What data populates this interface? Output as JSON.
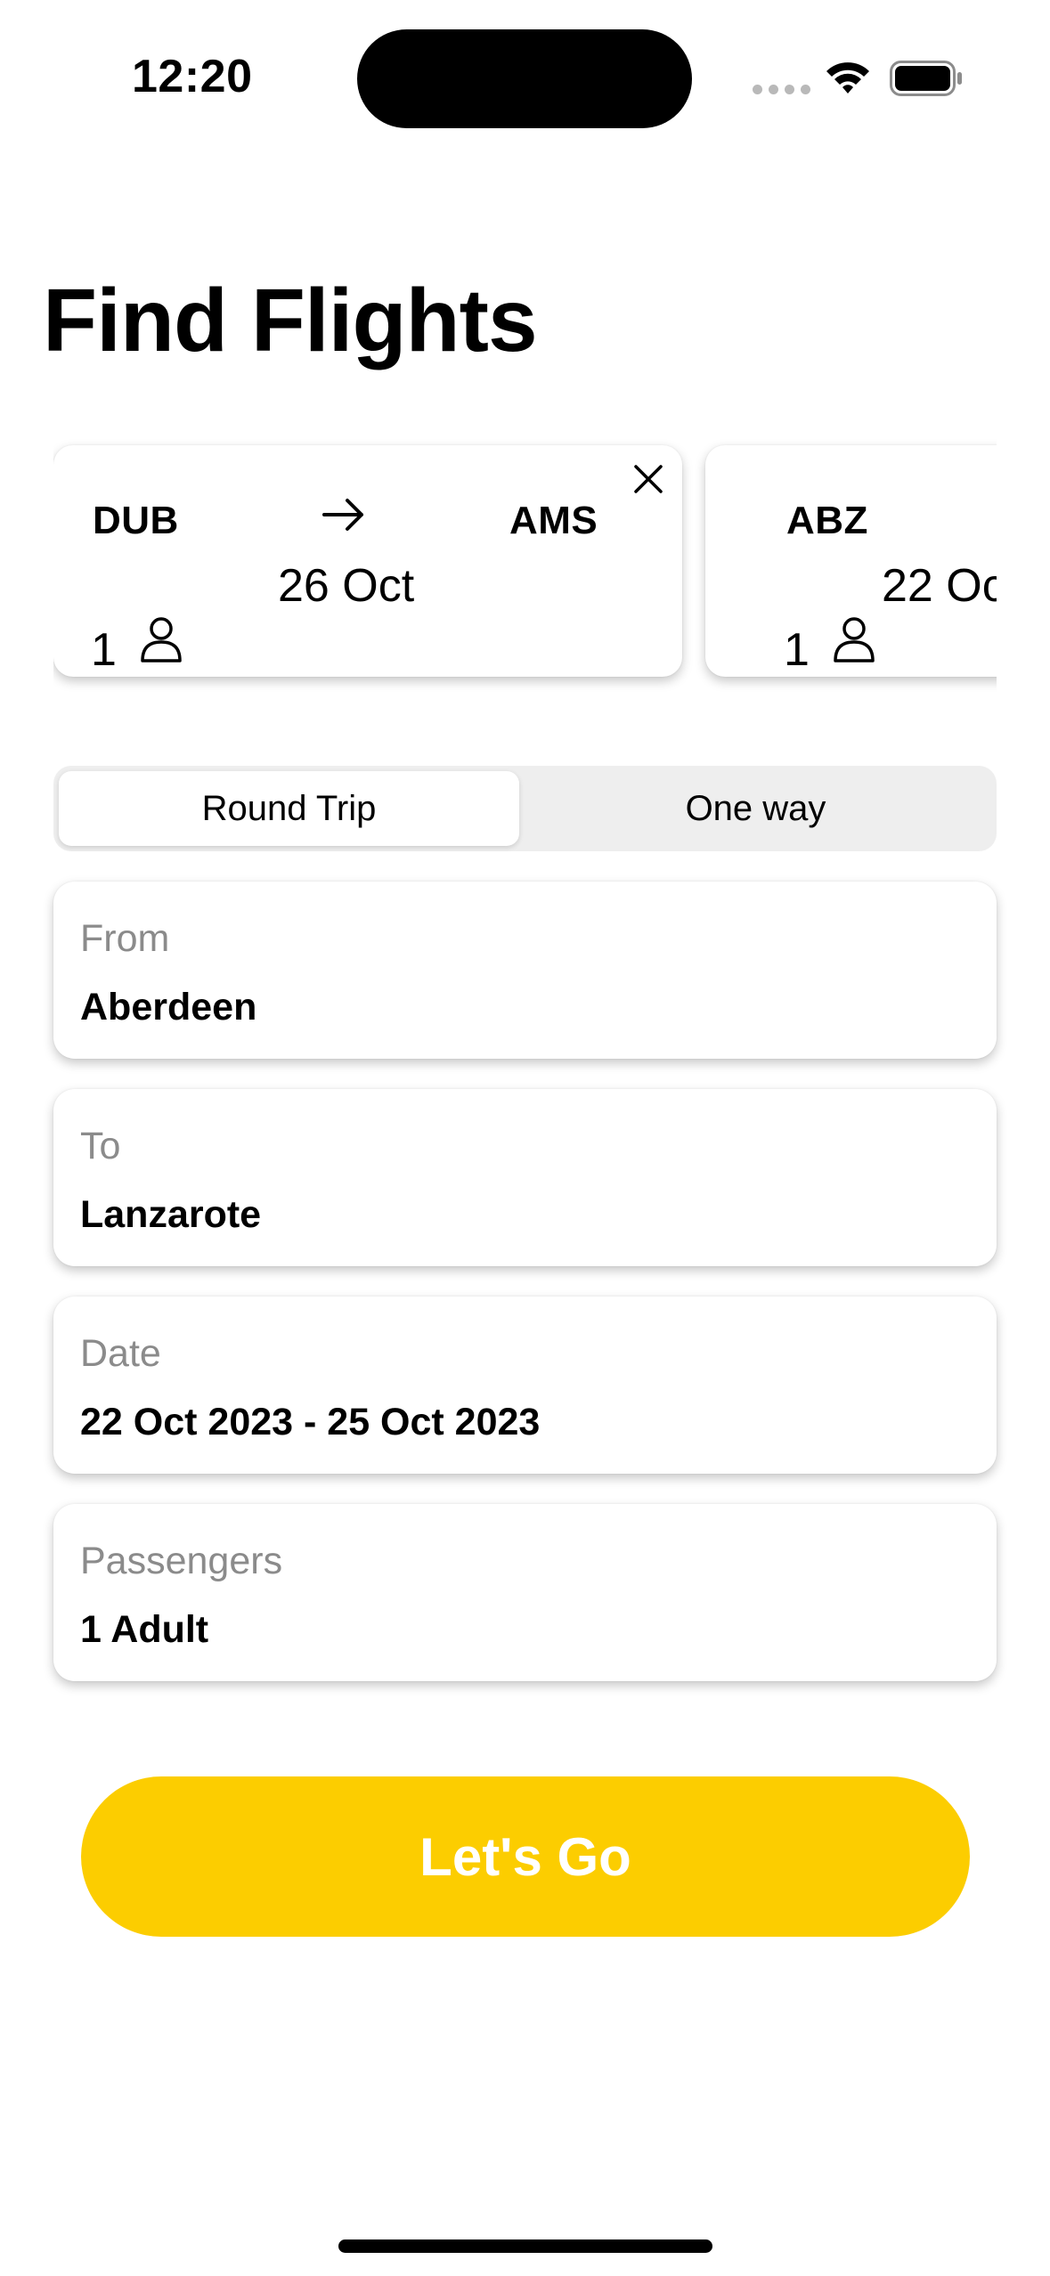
{
  "status_bar": {
    "time": "12:20",
    "icons": [
      "cellular-signal-icon",
      "wifi-icon",
      "battery-icon"
    ]
  },
  "title": "Find Flights",
  "recent_searches": [
    {
      "from": "DUB",
      "to": "AMS",
      "date": "26 Oct",
      "passengers": "1",
      "icons": [
        "arrow-right-icon",
        "person-icon",
        "close-icon"
      ]
    },
    {
      "from": "ABZ",
      "date": "22 Oc",
      "passengers": "1",
      "icons": [
        "person-icon"
      ]
    }
  ],
  "trip_type": {
    "options": [
      "Round Trip",
      "One way"
    ],
    "selected": "Round Trip"
  },
  "form": {
    "from": {
      "label": "From",
      "value": "Aberdeen"
    },
    "to": {
      "label": "To",
      "value": "Lanzarote"
    },
    "date": {
      "label": "Date",
      "value": "22 Oct 2023 - 25 Oct 2023"
    },
    "passengers": {
      "label": "Passengers",
      "value": "1 Adult"
    }
  },
  "cta_label": "Let's Go",
  "colors": {
    "accent": "#fccd00",
    "label_gray": "#8b8b8b",
    "segment_background": "#eeeeee"
  }
}
